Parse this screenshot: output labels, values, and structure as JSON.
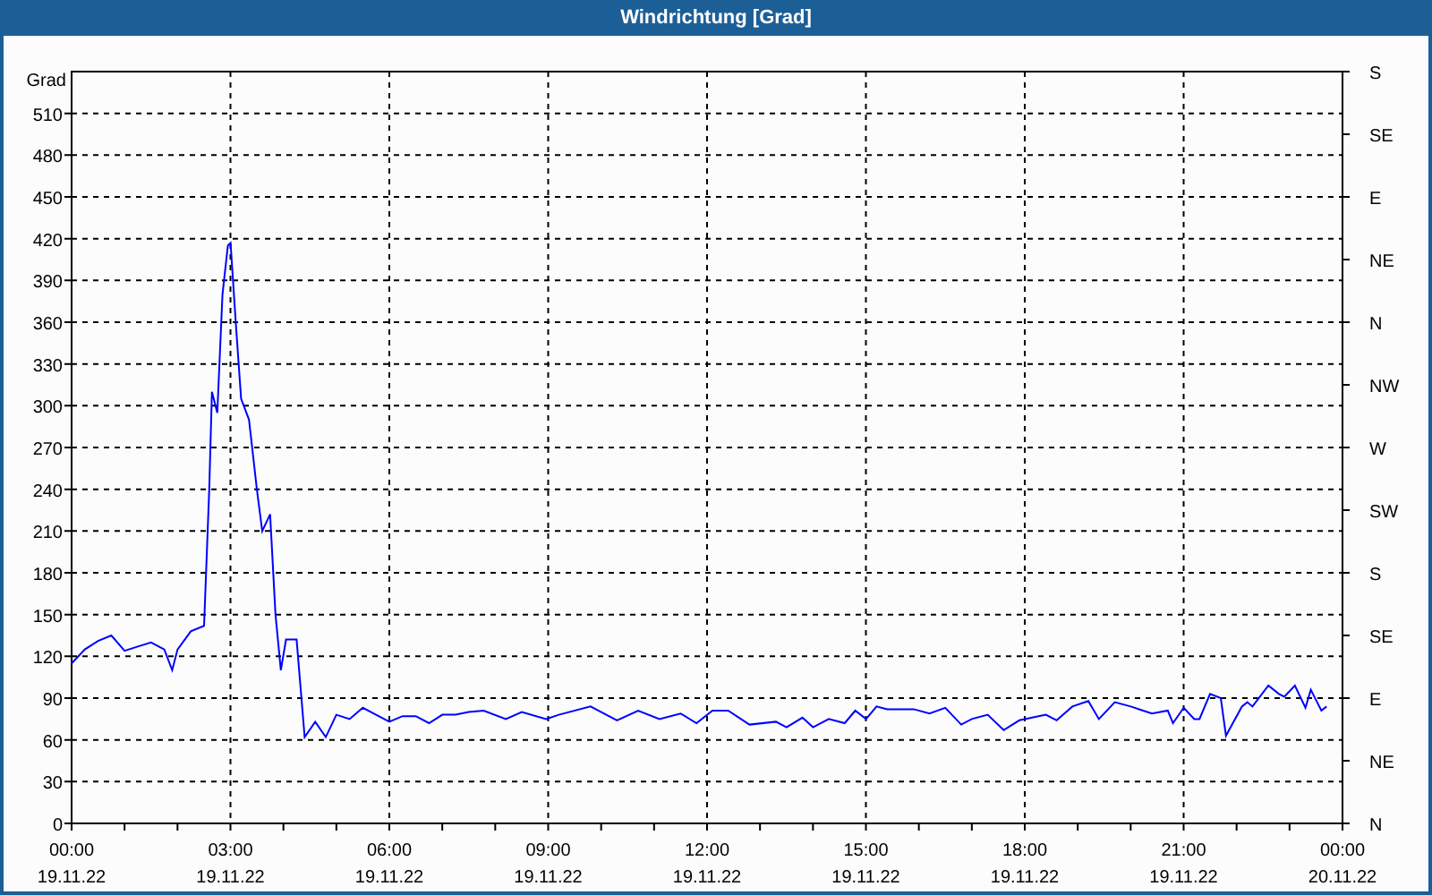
{
  "window": {
    "title": "Windrichtung [Grad]"
  },
  "chart": {
    "chart_data": {
      "type": "line",
      "ylabel": "Grad",
      "xlim": [
        0,
        24
      ],
      "ylim": [
        0,
        540
      ],
      "grid": true,
      "yticks": [
        0,
        30,
        60,
        90,
        120,
        150,
        180,
        210,
        240,
        270,
        300,
        330,
        360,
        390,
        420,
        450,
        480,
        510
      ],
      "xticks": [
        {
          "value": 0,
          "label": "00:00"
        },
        {
          "value": 3,
          "label": "03:00"
        },
        {
          "value": 6,
          "label": "06:00"
        },
        {
          "value": 9,
          "label": "09:00"
        },
        {
          "value": 12,
          "label": "12:00"
        },
        {
          "value": 15,
          "label": "15:00"
        },
        {
          "value": 18,
          "label": "18:00"
        },
        {
          "value": 21,
          "label": "21:00"
        },
        {
          "value": 24,
          "label": "00:00"
        }
      ],
      "x": [
        0,
        0.25,
        0.5,
        0.75,
        1,
        1.25,
        1.5,
        1.75,
        1.9,
        2,
        2.25,
        2.5,
        2.6,
        2.65,
        2.75,
        2.85,
        2.95,
        3,
        3.1,
        3.2,
        3.35,
        3.5,
        3.6,
        3.75,
        3.85,
        3.95,
        4.05,
        4.25,
        4.4,
        4.6,
        4.8,
        5,
        5.25,
        5.5,
        5.75,
        6,
        6.25,
        6.5,
        6.75,
        7,
        7.25,
        7.5,
        7.78,
        8.2,
        8.5,
        8.96,
        9.2,
        9.8,
        10.3,
        10.7,
        11.1,
        11.5,
        11.8,
        12.1,
        12.4,
        12.8,
        13.3,
        13.5,
        13.8,
        14,
        14.3,
        14.6,
        14.8,
        15,
        15.2,
        15.4,
        15.9,
        16.2,
        16.5,
        16.8,
        17,
        17.3,
        17.6,
        17.9,
        18.4,
        18.6,
        18.9,
        19.2,
        19.4,
        19.7,
        20,
        20.4,
        20.7,
        20.8,
        21,
        21.2,
        21.3,
        21.5,
        21.7,
        21.8,
        22.1,
        22.2,
        22.3,
        22.6,
        22.8,
        22.9,
        23.1,
        23.3,
        23.4,
        23.6,
        23.7
      ],
      "series": [
        {
          "color": "#0000ff",
          "values": [
            115,
            125,
            131,
            135,
            124,
            127,
            130,
            125,
            110,
            125,
            138,
            142,
            240,
            310,
            295,
            380,
            415,
            417,
            360,
            305,
            290,
            240,
            210,
            222,
            150,
            110,
            132,
            132,
            62,
            73,
            62,
            78,
            75,
            83,
            78,
            73,
            77,
            77,
            72,
            78,
            78,
            80,
            81,
            75,
            80,
            75,
            78,
            84,
            74,
            81,
            75,
            79,
            72,
            81,
            81,
            71,
            73,
            69,
            76,
            69,
            75,
            72,
            81,
            75,
            84,
            82,
            82,
            79,
            83,
            71,
            75,
            78,
            67,
            74,
            78,
            74,
            84,
            88,
            75,
            87,
            84,
            79,
            81,
            72,
            83,
            75,
            75,
            93,
            90,
            63,
            84,
            87,
            84,
            99,
            93,
            91,
            99,
            83,
            96,
            81,
            84
          ]
        }
      ]
    },
    "x_dates": [
      "19.11.22",
      "19.11.22",
      "19.11.22",
      "19.11.22",
      "19.11.22",
      "19.11.22",
      "19.11.22",
      "19.11.22",
      "20.11.22"
    ],
    "compass_labels": [
      "S",
      "SE",
      "E",
      "NE",
      "N",
      "NW",
      "W",
      "SW",
      "S",
      "SE",
      "E",
      "NE",
      "N"
    ]
  }
}
